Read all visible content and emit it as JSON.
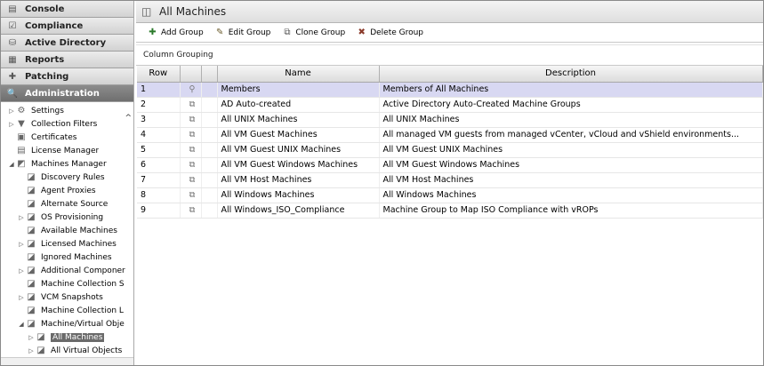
{
  "nav": {
    "sliders": [
      {
        "label": "Console",
        "icon": "console-icon"
      },
      {
        "label": "Compliance",
        "icon": "compliance-icon"
      },
      {
        "label": "Active Directory",
        "icon": "active-directory-icon"
      },
      {
        "label": "Reports",
        "icon": "reports-icon"
      },
      {
        "label": "Patching",
        "icon": "patching-icon"
      },
      {
        "label": "Administration",
        "icon": "administration-icon",
        "active": true
      }
    ],
    "tree": [
      {
        "label": "Settings",
        "level": 0,
        "arrow": "▷",
        "icon": "settings-icon"
      },
      {
        "label": "Collection Filters",
        "level": 0,
        "arrow": "▷",
        "icon": "filter-icon"
      },
      {
        "label": "Certificates",
        "level": 0,
        "arrow": "",
        "icon": "certificate-icon"
      },
      {
        "label": "License Manager",
        "level": 0,
        "arrow": "",
        "icon": "license-icon"
      },
      {
        "label": "Machines Manager",
        "level": 0,
        "arrow": "◢",
        "icon": "machines-icon"
      },
      {
        "label": "Discovery Rules",
        "level": 1,
        "arrow": "",
        "icon": "discovery-icon"
      },
      {
        "label": "Agent Proxies",
        "level": 1,
        "arrow": "",
        "icon": "proxy-icon"
      },
      {
        "label": "Alternate Source",
        "level": 1,
        "arrow": "",
        "icon": "source-icon"
      },
      {
        "label": "OS Provisioning",
        "level": 1,
        "arrow": "▷",
        "icon": "os-icon"
      },
      {
        "label": "Available Machines",
        "level": 1,
        "arrow": "",
        "icon": "machine-icon"
      },
      {
        "label": "Licensed Machines",
        "level": 1,
        "arrow": "▷",
        "icon": "licensed-icon"
      },
      {
        "label": "Ignored Machines",
        "level": 1,
        "arrow": "",
        "icon": "ignored-icon"
      },
      {
        "label": "Additional Componer",
        "level": 1,
        "arrow": "▷",
        "icon": "component-icon"
      },
      {
        "label": "Machine Collection S",
        "level": 1,
        "arrow": "",
        "icon": "collection-icon"
      },
      {
        "label": "VCM Snapshots",
        "level": 1,
        "arrow": "▷",
        "icon": "snapshot-icon"
      },
      {
        "label": "Machine Collection L",
        "level": 1,
        "arrow": "",
        "icon": "collection-log-icon"
      },
      {
        "label": "Machine/Virtual Obje",
        "level": 1,
        "arrow": "◢",
        "icon": "virtual-object-icon"
      },
      {
        "label": "All Machines",
        "level": 2,
        "arrow": "▷",
        "icon": "group-icon",
        "selected": true
      },
      {
        "label": "All Virtual Objects",
        "level": 2,
        "arrow": "▷",
        "icon": "group-icon"
      }
    ]
  },
  "main": {
    "title": "All Machines",
    "toolbar": {
      "add_group": "Add Group",
      "edit_group": "Edit Group",
      "clone_group": "Clone Group",
      "delete_group": "Delete Group"
    },
    "column_grouping": "Column Grouping",
    "columns": {
      "row": "Row",
      "name": "Name",
      "description": "Description"
    },
    "rows": [
      {
        "row": "1",
        "name": "Members",
        "description": "Members of All Machines",
        "selected": true
      },
      {
        "row": "2",
        "name": "AD Auto-created",
        "description": "Active Directory Auto-Created Machine Groups"
      },
      {
        "row": "3",
        "name": "All UNIX Machines",
        "description": "All UNIX Machines"
      },
      {
        "row": "4",
        "name": "All VM Guest Machines",
        "description": "All managed VM guests from managed vCenter, vCloud and vShield environments..."
      },
      {
        "row": "5",
        "name": "All VM Guest UNIX Machines",
        "description": "All VM Guest UNIX Machines"
      },
      {
        "row": "6",
        "name": "All VM Guest Windows Machines",
        "description": "All VM Guest Windows Machines"
      },
      {
        "row": "7",
        "name": "All VM Host Machines",
        "description": "All VM Host Machines"
      },
      {
        "row": "8",
        "name": "All Windows Machines",
        "description": "All Windows Machines"
      },
      {
        "row": "9",
        "name": "All Windows_ISO_Compliance",
        "description": "Machine Group to Map ISO Compliance with vROPs"
      }
    ]
  }
}
